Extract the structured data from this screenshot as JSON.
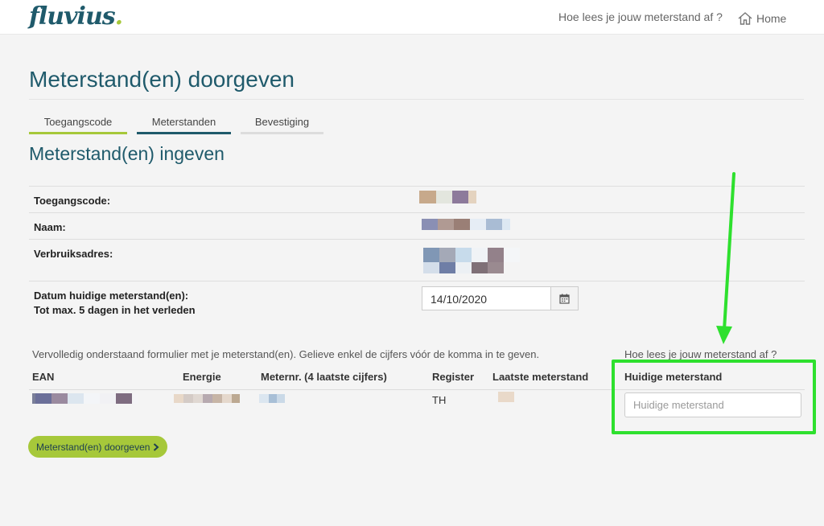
{
  "header": {
    "logo": "fluvius",
    "logo_dot": ".",
    "howto_link": "Hoe lees je jouw meterstand af ?",
    "home_link": "Home"
  },
  "page": {
    "title": "Meterstand(en) doorgeven",
    "subtitle": "Meterstand(en) ingeven"
  },
  "steps": [
    "Toegangscode",
    "Meterstanden",
    "Bevestiging"
  ],
  "info": {
    "access_code_label": "Toegangscode:",
    "name_label": "Naam:",
    "address_label": "Verbruiksadres:",
    "date_label_1": "Datum huidige meterstand(en):",
    "date_label_2": "Tot max. 5 dagen in het verleden",
    "date_value": "14/10/2020"
  },
  "form": {
    "instruction": "Vervolledig onderstaand formulier met je meterstand(en). Gelieve enkel de cijfers vóór de komma in te geven.",
    "howto_link": "Hoe lees je jouw meterstand af ?",
    "columns": {
      "ean": "EAN",
      "energy": "Energie",
      "meter": "Meternr. (4 laatste cijfers)",
      "register": "Register",
      "last": "Laatste meterstand",
      "current": "Huidige meterstand"
    },
    "row": {
      "register": "TH"
    },
    "current_placeholder": "Huidige meterstand",
    "submit_label": "Meterstand(en) doorgeven"
  },
  "colors": {
    "brand_teal": "#1f5a6b",
    "brand_green": "#a6c83a",
    "annotation_green": "#2ee02e"
  }
}
